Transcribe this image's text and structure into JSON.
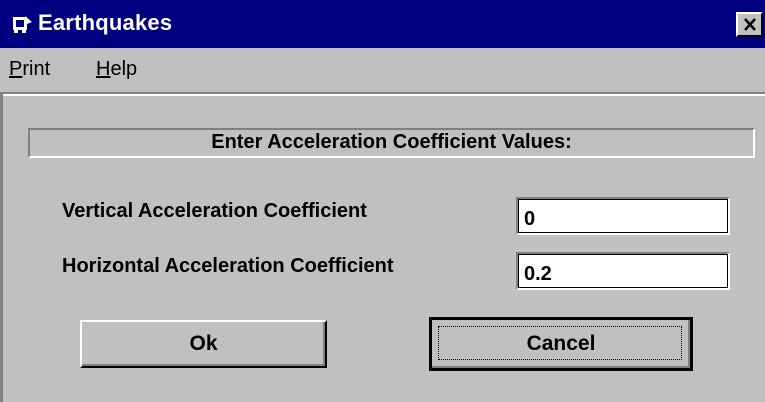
{
  "window": {
    "title": "Earthquakes",
    "icon": "app-icon",
    "close_icon": "close-icon",
    "title_bar_color": "#000080",
    "face_color": "#c0c0c0"
  },
  "menu": {
    "print": {
      "accelerator": "P",
      "rest": "rint"
    },
    "help": {
      "accelerator": "H",
      "rest": "elp"
    }
  },
  "form": {
    "header": "Enter Acceleration Coefficient Values:",
    "vertical_label": "Vertical Acceleration Coefficient",
    "vertical_value": "0",
    "horizontal_label": "Horizontal Acceleration Coefficient",
    "horizontal_value": "0.2"
  },
  "buttons": {
    "ok": "Ok",
    "cancel": "Cancel"
  }
}
